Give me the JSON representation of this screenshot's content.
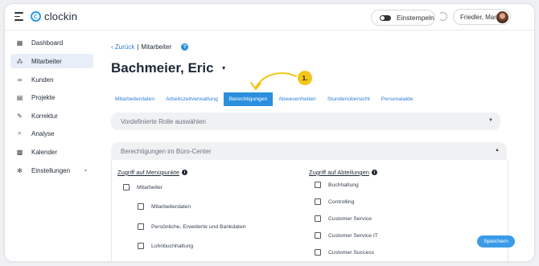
{
  "app": {
    "name": "clockin"
  },
  "topbar": {
    "clockin_label": "Einstempeln",
    "user_name": "Friedler, Maria"
  },
  "sidebar": {
    "items": [
      {
        "label": "Dashboard",
        "icon": "dashboard-icon"
      },
      {
        "label": "Mitarbeiter",
        "icon": "employees-icon",
        "active": true
      },
      {
        "label": "Kunden",
        "icon": "handshake-icon"
      },
      {
        "label": "Projekte",
        "icon": "projects-icon"
      },
      {
        "label": "Korrektur",
        "icon": "correction-icon"
      },
      {
        "label": "Analyse",
        "icon": "search-icon"
      },
      {
        "label": "Kalender",
        "icon": "calendar-icon"
      },
      {
        "label": "Einstellungen",
        "icon": "gear-icon",
        "expandable": true
      }
    ]
  },
  "breadcrumb": {
    "back": "Zurück",
    "separator": "|",
    "current": "Mitarbeiter"
  },
  "page": {
    "title": "Bachmeier, Eric"
  },
  "annotation": {
    "step": "1."
  },
  "tabs": [
    {
      "label": "Mitarbeiterdaten"
    },
    {
      "label": "Arbeitszeitverwaltung"
    },
    {
      "label": "Berechtigungen",
      "active": true
    },
    {
      "label": "Abwesenheiten"
    },
    {
      "label": "Stundenübersicht"
    },
    {
      "label": "Personalakte"
    }
  ],
  "role_select": {
    "placeholder": "Vordefinierte Rolle auswählen"
  },
  "office_panel": {
    "title": "Berechtigungen im Büro-Center"
  },
  "menu_access": {
    "heading": "Zugriff auf Menüpunkte",
    "items": [
      {
        "label": "Mitarbeiter",
        "checked": false
      },
      {
        "label": "Mitarbeiterdaten",
        "checked": false
      },
      {
        "label": "Persönliche, Erweiterte und Bankdaten",
        "checked": false
      },
      {
        "label": "Lohnbuchhaltung",
        "checked": false
      }
    ]
  },
  "department_access": {
    "heading": "Zugriff auf Abteilungen",
    "items": [
      {
        "label": "Buchhaltung",
        "checked": false
      },
      {
        "label": "Controlling",
        "checked": false
      },
      {
        "label": "Customer Service",
        "checked": false
      },
      {
        "label": "Customer Service IT",
        "checked": false
      },
      {
        "label": "Customer Success",
        "checked": false
      }
    ]
  },
  "actions": {
    "save": "Speichern"
  },
  "colors": {
    "accent": "#2b8fde",
    "annotation": "#f5c518"
  }
}
